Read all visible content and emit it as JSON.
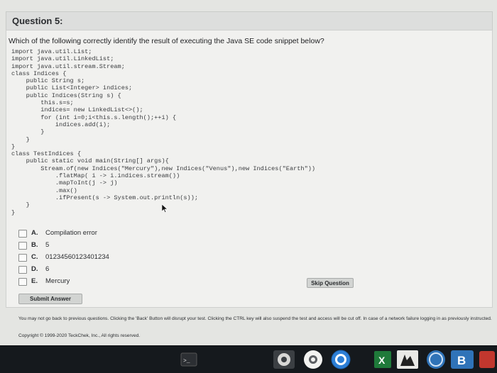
{
  "question": {
    "title": "Question 5:",
    "prompt": "Which of the following correctly identify the result of executing the Java SE code snippet below?"
  },
  "code_lines": [
    "import java.util.List;",
    "import java.util.LinkedList;",
    "import java.util.stream.Stream;",
    "class Indices {",
    "    public String s;",
    "    public List<Integer> indices;",
    "    public Indices(String s) {",
    "        this.s=s;",
    "        indices= new LinkedList<>();",
    "        for (int i=0;i<this.s.length();++i) {",
    "            indices.add(i);",
    "        }",
    "    }",
    "}",
    "class TestIndices {",
    "    public static void main(String[] args){",
    "        Stream.of(new Indices(\"Mercury\"),new Indices(\"Venus\"),new Indices(\"Earth\"))",
    "            .flatMap( i -> i.indices.stream())",
    "            .mapToInt(j -> j)",
    "            .max()",
    "            .ifPresent(s -> System.out.println(s));",
    "    }",
    "}"
  ],
  "options": [
    {
      "letter": "A.",
      "text": "Compilation error"
    },
    {
      "letter": "B.",
      "text": "5"
    },
    {
      "letter": "C.",
      "text": "01234560123401234"
    },
    {
      "letter": "D.",
      "text": "6"
    },
    {
      "letter": "E.",
      "text": "Mercury"
    }
  ],
  "buttons": {
    "submit": "Submit Answer",
    "skip": "Skip Question"
  },
  "footer": {
    "notice": "You may not go back to previous questions. Clicking the 'Back' Button will disrupt your test. Clicking the CTRL key will also suspend the test and access will be cut off. In case of a network failure logging in as previously instructed.",
    "copyright": "Copyright © 1999-2020 TeckChek, Inc., All rights reserved."
  },
  "taskbar": {
    "terminal_glyph": ">_",
    "excel_glyph": "X",
    "b_glyph": "B"
  },
  "colors": {
    "chrome_blue": "#2d7fd6",
    "excel_green": "#1f7a3a",
    "bluebook_blue": "#2f73b8"
  }
}
